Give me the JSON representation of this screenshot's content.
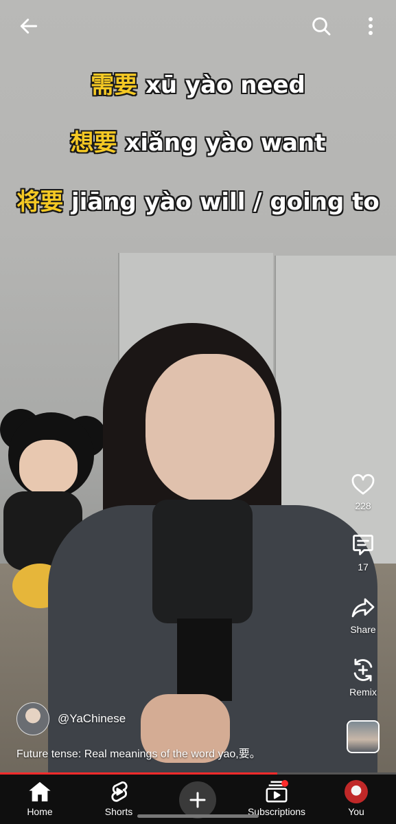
{
  "captions": [
    {
      "zh": "需要",
      "rest": " xū yào need"
    },
    {
      "zh": "想要",
      "rest": " xiǎng yào want"
    },
    {
      "zh": "将要",
      "rest": " jiāng yào will / going to"
    }
  ],
  "icons": {
    "back": "arrow-left-icon",
    "search": "search-icon",
    "more": "more-vertical-icon"
  },
  "actions": {
    "like_count": "228",
    "comment_count": "17",
    "share_label": "Share",
    "remix_label": "Remix"
  },
  "channel": {
    "handle": "@YaChinese"
  },
  "description": "Future tense: Real meanings of the word yao,要。",
  "progress": 0.7,
  "nav": {
    "home": "Home",
    "shorts": "Shorts",
    "subscriptions": "Subscriptions",
    "you": "You"
  },
  "colors": {
    "highlight": "#f5c924",
    "progress": "#ff2b2b",
    "nav_bg": "#0f0f0f"
  }
}
